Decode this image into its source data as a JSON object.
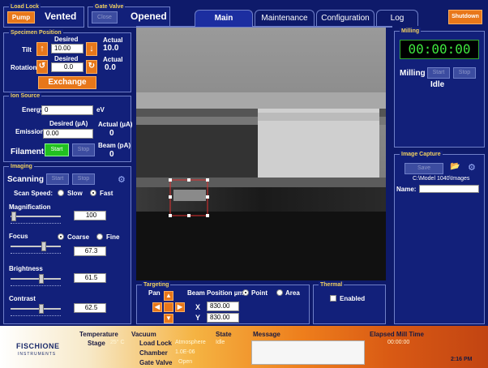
{
  "loadlock": {
    "title": "Load Lock",
    "pump": "Pump",
    "state": "Vented"
  },
  "gatevalve": {
    "title": "Gate Valve",
    "close": "Close",
    "state": "Opened"
  },
  "tabs": [
    "Main",
    "Maintenance",
    "Configuration",
    "Log"
  ],
  "shutdown": "Shutdown",
  "specimen": {
    "title": "Specimen Position",
    "desired_hdr": "Desired",
    "actual_hdr": "Actual",
    "tilt_label": "Tilt",
    "tilt_desired": "10.00",
    "tilt_actual": "10.0",
    "rotation_label": "Rotation",
    "rotation_desired_hdr": "Desired",
    "rotation_desired": "0.0",
    "rotation_actual_hdr": "Actual",
    "rotation_actual": "0.0",
    "exchange": "Exchange"
  },
  "ionsource": {
    "title": "Ion Source",
    "energy_label": "Energy:",
    "energy_value": "0",
    "energy_unit": "eV",
    "desired_hdr": "Desired (µA)",
    "actual_hdr": "Actual (µA)",
    "emission_label": "Emission:",
    "emission_value": "0.00",
    "emission_actual": "0",
    "filament_label": "Filament",
    "start": "Start",
    "stop": "Stop",
    "beam_hdr": "Beam (pA)",
    "beam_value": "0"
  },
  "imaging": {
    "title": "Imaging",
    "scanning": "Scanning",
    "start": "Start",
    "stop": "Stop",
    "scan_speed_label": "Scan Speed:",
    "slow": "Slow",
    "fast": "Fast",
    "magnification_label": "Magnification",
    "magnification_value": "100",
    "magnification_level": 0.02,
    "focus_label": "Focus",
    "coarse": "Coarse",
    "fine": "Fine",
    "focus_value": "67.3",
    "focus_level": 0.67,
    "brightness_label": "Brightness",
    "brightness_value": "61.5",
    "brightness_level": 0.62,
    "contrast_label": "Contrast",
    "contrast_value": "62.5",
    "contrast_level": 0.62
  },
  "targeting": {
    "title": "Targeting",
    "pan": "Pan",
    "beam_pos": "Beam Position µm",
    "point": "Point",
    "area": "Area",
    "x_label": "X",
    "y_label": "Y",
    "x_value": "830.00",
    "y_value": "830.00"
  },
  "thermal": {
    "title": "Thermal",
    "enabled": "Enabled"
  },
  "milling": {
    "title": "Milling",
    "timer": "00:00:00",
    "label": "Milling",
    "start": "Start",
    "stop": "Stop",
    "status": "Idle"
  },
  "capture": {
    "title": "Image Capture",
    "save": "Save",
    "path": "C:\\Model 1040\\Images",
    "name_label": "Name:"
  },
  "footer": {
    "logo": "FISCHIONE",
    "logo_sub": "INSTRUMENTS",
    "temperature_hdr": "Temperature",
    "stage_label": "Stage",
    "stage_value": "25° C",
    "vacuum_hdr": "Vacuum",
    "state_hdr": "State",
    "loadlock_label": "Load Lock",
    "loadlock_value": "Atmosphere",
    "loadlock_state": "Idle",
    "chamber_label": "Chamber",
    "chamber_value": "1.0E-06",
    "gatevalve_label": "Gate Valve",
    "gatevalve_value": "Open",
    "message_hdr": "Message",
    "elapsed_hdr": "Elapsed Mill Time",
    "elapsed_value": "00:00:00",
    "clock": "2:16 PM"
  }
}
